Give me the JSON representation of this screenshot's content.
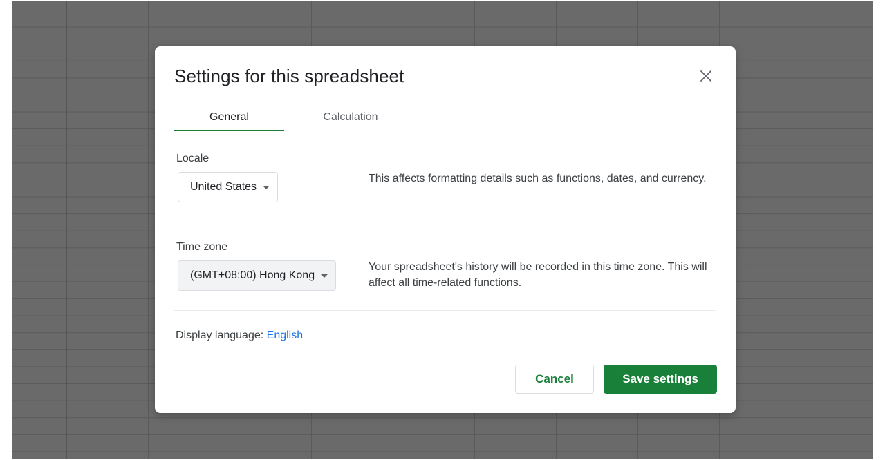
{
  "dialog": {
    "title": "Settings for this spreadsheet",
    "close_icon": "close-icon"
  },
  "tabs": [
    {
      "label": "General",
      "active": true
    },
    {
      "label": "Calculation",
      "active": false
    }
  ],
  "locale": {
    "label": "Locale",
    "value": "United States",
    "description": "This affects formatting details such as functions, dates, and currency."
  },
  "timezone": {
    "label": "Time zone",
    "value": "(GMT+08:00) Hong Kong",
    "description": "Your spreadsheet's history will be recorded in this time zone. This will affect all time-related functions."
  },
  "display_language": {
    "label": "Display language:",
    "value": "English"
  },
  "buttons": {
    "cancel": "Cancel",
    "save": "Save settings"
  },
  "colors": {
    "accent_green": "#188038",
    "link_blue": "#1a73e8",
    "overlay_gray": "#6a6a6a"
  }
}
